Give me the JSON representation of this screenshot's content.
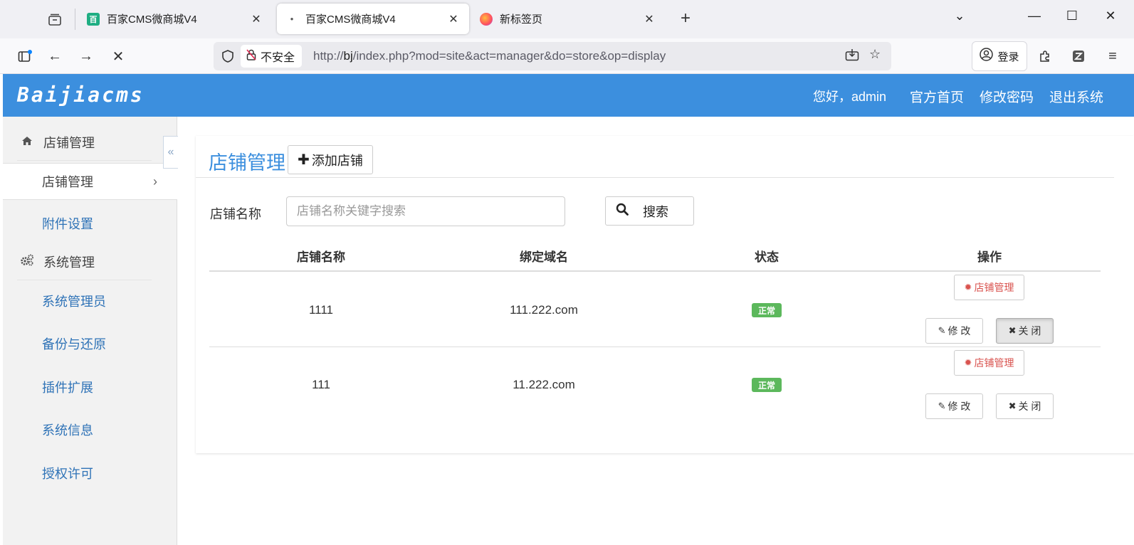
{
  "browser": {
    "tabs": [
      {
        "title": "百家CMS微商城V4",
        "active": false
      },
      {
        "title": "百家CMS微商城V4",
        "active": true
      },
      {
        "title": "新标签页",
        "active": false
      }
    ],
    "security_label": "不安全",
    "url_prefix": "http://",
    "url_host": "bj",
    "url_path": "/index.php?mod=site&act=manager&do=store&op=display",
    "login_label": "登录"
  },
  "header": {
    "logo": "Baijiacms",
    "greeting": "您好，admin",
    "links": [
      "官方首页",
      "修改密码",
      "退出系统"
    ]
  },
  "sidebar": {
    "sections": [
      {
        "label": "店铺管理",
        "icon": "home-icon",
        "items": [
          {
            "label": "店铺管理",
            "active": true
          },
          {
            "label": "附件设置",
            "active": false
          }
        ]
      },
      {
        "label": "系统管理",
        "icon": "cogs-icon",
        "items": [
          {
            "label": "系统管理员",
            "active": false
          },
          {
            "label": "备份与还原",
            "active": false
          },
          {
            "label": "插件扩展",
            "active": false
          },
          {
            "label": "系统信息",
            "active": false
          },
          {
            "label": "授权许可",
            "active": false
          }
        ]
      }
    ]
  },
  "main": {
    "title": "店铺管理",
    "add_button": "添加店铺",
    "search": {
      "label": "店铺名称",
      "placeholder": "店铺名称关键字搜索",
      "value": "",
      "button": "搜索"
    },
    "table": {
      "columns": [
        "店铺名称",
        "绑定域名",
        "状态",
        "操作"
      ],
      "rows": [
        {
          "name": "1111",
          "domain": "111.222.com",
          "status": "正常"
        },
        {
          "name": "111",
          "domain": "11.222.com",
          "status": "正常"
        }
      ],
      "actions": {
        "manage": "店铺管理",
        "edit": "修 改",
        "close": "关 闭"
      }
    }
  },
  "colors": {
    "header_bg": "#3c8fde",
    "status_ok": "#5cb85c",
    "manage_text": "#d9534f",
    "sidebar_link": "#2f73b7"
  }
}
